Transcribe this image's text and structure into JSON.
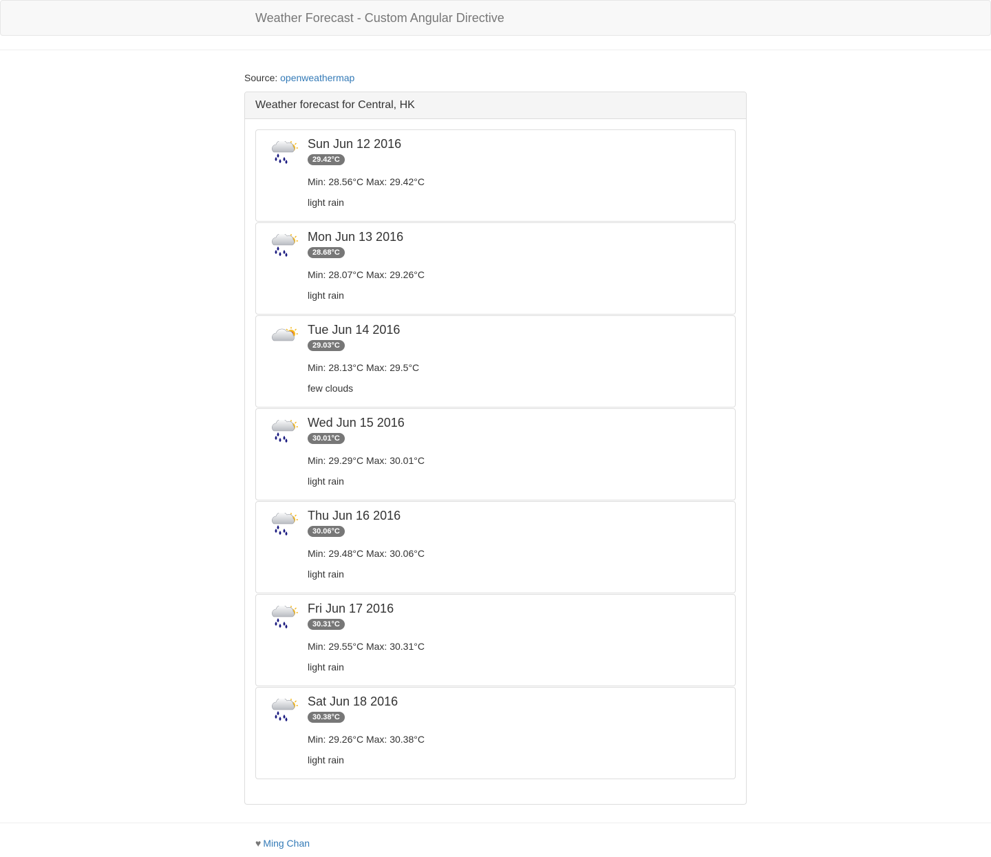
{
  "navbar": {
    "brand": "Weather Forecast - Custom Angular Directive"
  },
  "source": {
    "label": "Source:",
    "link_text": "openweathermap"
  },
  "panel": {
    "heading": "Weather forecast for Central, HK"
  },
  "days": [
    {
      "date": "Sun Jun 12 2016",
      "temp": "29.42°C",
      "minmax": "Min: 28.56°C Max: 29.42°C",
      "description": "light rain",
      "icon": "rain-sun-icon"
    },
    {
      "date": "Mon Jun 13 2016",
      "temp": "28.68°C",
      "minmax": "Min: 28.07°C Max: 29.26°C",
      "description": "light rain",
      "icon": "rain-sun-icon"
    },
    {
      "date": "Tue Jun 14 2016",
      "temp": "29.03°C",
      "minmax": "Min: 28.13°C Max: 29.5°C",
      "description": "few clouds",
      "icon": "cloud-sun-icon"
    },
    {
      "date": "Wed Jun 15 2016",
      "temp": "30.01°C",
      "minmax": "Min: 29.29°C Max: 30.01°C",
      "description": "light rain",
      "icon": "rain-sun-icon"
    },
    {
      "date": "Thu Jun 16 2016",
      "temp": "30.06°C",
      "minmax": "Min: 29.48°C Max: 30.06°C",
      "description": "light rain",
      "icon": "rain-sun-icon"
    },
    {
      "date": "Fri Jun 17 2016",
      "temp": "30.31°C",
      "minmax": "Min: 29.55°C Max: 30.31°C",
      "description": "light rain",
      "icon": "rain-sun-icon"
    },
    {
      "date": "Sat Jun 18 2016",
      "temp": "30.38°C",
      "minmax": "Min: 29.26°C Max: 30.38°C",
      "description": "light rain",
      "icon": "rain-sun-icon"
    }
  ],
  "footer": {
    "author": "Ming Chan",
    "icon": "heart-icon"
  },
  "colors": {
    "link": "#337ab7",
    "badge": "#777777",
    "rain_drop": "#1a1a80",
    "sun": "#f6b91d",
    "sun_core": "#e03a1e"
  }
}
